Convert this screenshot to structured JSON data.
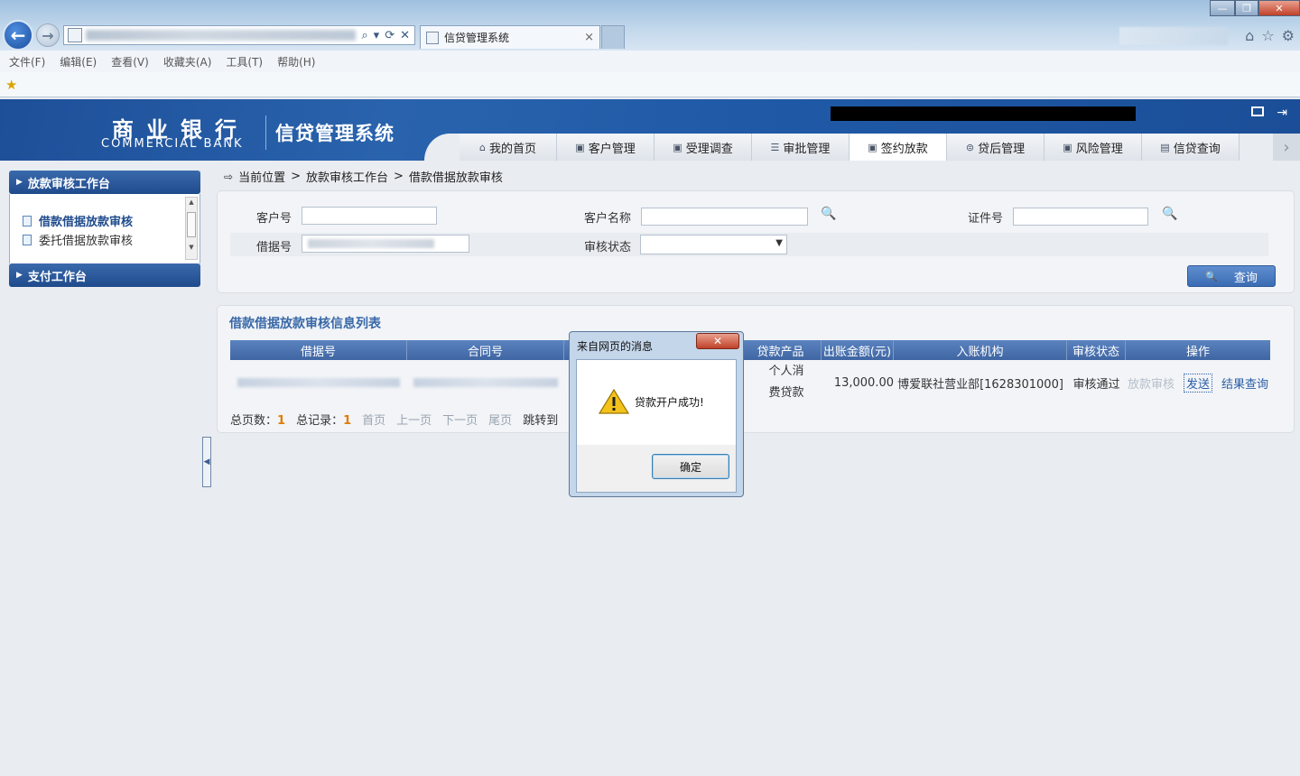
{
  "browser": {
    "tab_title": "信贷管理系统",
    "tab_close": "×",
    "back_glyph": "←",
    "forward_glyph": "→",
    "addr_tools": [
      "⌕",
      "▾",
      "⟳",
      "✕"
    ],
    "window_controls": {
      "minimize": "—",
      "maximize": "❐",
      "close": "✕"
    },
    "right_icons": [
      "⌂",
      "☆",
      "⚙"
    ],
    "menu": [
      "文件(F)",
      "编辑(E)",
      "查看(V)",
      "收藏夹(A)",
      "工具(T)",
      "帮助(H)"
    ],
    "fav_icon": "★"
  },
  "header": {
    "bank_cn": "商业银行",
    "bank_en": "COMMERCIAL BANK",
    "system_title": "信贷管理系统",
    "logout_glyph": "⇥",
    "nav_more": "›",
    "nav": [
      {
        "label": "我的首页",
        "icon": "home-icon",
        "glyph": "⌂",
        "active": false
      },
      {
        "label": "客户管理",
        "icon": "customer-icon",
        "glyph": "▣",
        "active": false
      },
      {
        "label": "受理调查",
        "icon": "survey-icon",
        "glyph": "▣",
        "active": false
      },
      {
        "label": "审批管理",
        "icon": "approval-icon",
        "glyph": "☰",
        "active": false
      },
      {
        "label": "签约放款",
        "icon": "sign-icon",
        "glyph": "▣",
        "active": true
      },
      {
        "label": "贷后管理",
        "icon": "post-loan-icon",
        "glyph": "⊜",
        "active": false
      },
      {
        "label": "风险管理",
        "icon": "risk-icon",
        "glyph": "▣",
        "active": false
      },
      {
        "label": "信贷查询",
        "icon": "query-icon",
        "glyph": "▤",
        "active": false
      }
    ]
  },
  "sidebar": {
    "section1": "放款审核工作台",
    "items": [
      "借款借据放款审核",
      "委托借据放款审核"
    ],
    "section2": "支付工作台",
    "triangle": "▶",
    "scroll_up": "▲",
    "scroll_down": "▼",
    "collapse": "◀"
  },
  "breadcrumb": {
    "icon": "⇨",
    "prefix": "当前位置",
    "sep": ">",
    "level1": "放款审核工作台",
    "level2": "借款借据放款审核"
  },
  "search": {
    "customer_no_label": "客户号",
    "customer_name_label": "客户名称",
    "id_no_label": "证件号",
    "loan_no_label": "借据号",
    "status_label": "审核状态",
    "magnifier": "🔍",
    "caret": "▼",
    "query_button": "查询"
  },
  "list": {
    "title": "借款借据放款审核信息列表",
    "columns": [
      "借据号",
      "合同号",
      "",
      "贷款产品",
      "出账金额(元)",
      "入账机构",
      "审核状态",
      "操作"
    ],
    "row": {
      "product": "个人消费贷款",
      "amount": "13,000.00",
      "org": "博爱联社营业部[1628301000]",
      "status": "审核通过",
      "op_disabled": "放款审核",
      "op_send": "发送",
      "op_result": "结果查询"
    },
    "pager": {
      "total_pages_label": "总页数：",
      "total_pages": "1",
      "total_records_label": "总记录：",
      "total_records": "1",
      "first": "首页",
      "prev": "上一页",
      "next": "下一页",
      "last": "尾页",
      "jump": "跳转到"
    }
  },
  "dialog": {
    "title": "来自网页的消息",
    "message": "贷款开户成功!",
    "ok": "确定",
    "close": "✕"
  }
}
